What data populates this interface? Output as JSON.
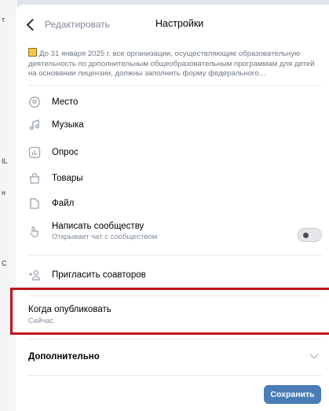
{
  "header": {
    "back_label": "Редактировать",
    "title": "Настройки"
  },
  "notice": "До 31 января 2025 г. все организации, осуществляющие образовательную деятельность по дополнительным общеобразовательным программам для детей на основании лицензии, должны заполнить форму федерального…",
  "attachments": [
    {
      "label": "Место",
      "icon": "location-pin-icon"
    },
    {
      "label": "Музыка",
      "icon": "music-note-icon"
    },
    {
      "label": "Опрос",
      "icon": "poll-icon"
    },
    {
      "label": "Товары",
      "icon": "shopping-bag-icon"
    },
    {
      "label": "Файл",
      "icon": "file-icon"
    }
  ],
  "message_community": {
    "label": "Написать сообществу",
    "sublabel": "Открывает чат с сообществом",
    "icon": "hand-pointer-icon",
    "enabled": false
  },
  "invite_coauthors": {
    "label": "Пригласить соавторов",
    "icon": "add-user-icon"
  },
  "publish": {
    "label": "Когда опубликовать",
    "value": "Сейчас"
  },
  "advanced": {
    "label": "Дополнительно"
  },
  "save_label": "Сохранить",
  "colors": {
    "accent": "#4a7db8",
    "highlight": "#c0121b"
  }
}
